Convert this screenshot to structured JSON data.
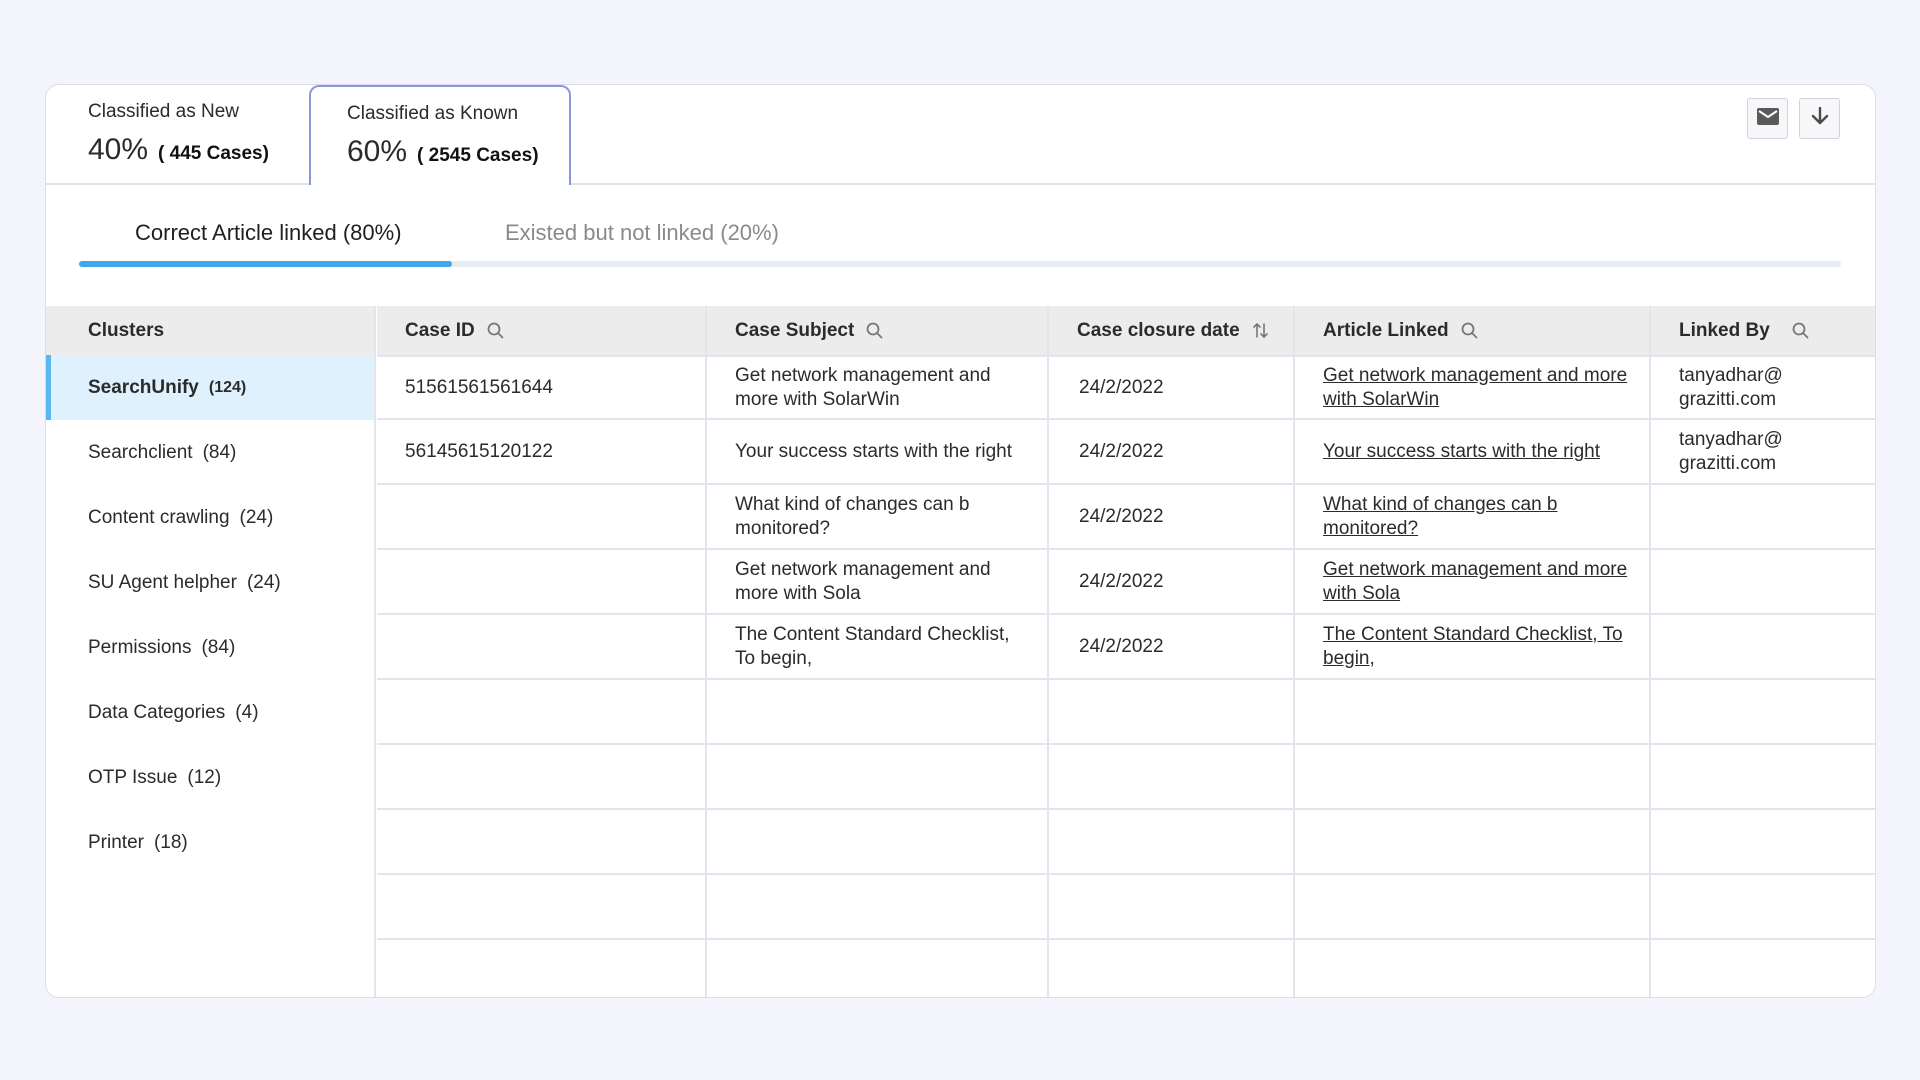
{
  "classification": {
    "new": {
      "label": "Classified as New",
      "percent": "40%",
      "cases": "( 445 Cases)"
    },
    "known": {
      "label": "Classified as Known",
      "percent": "60%",
      "cases": "( 2545 Cases)"
    }
  },
  "actions": {
    "mail_icon": "mail-icon",
    "download_icon": "download-icon"
  },
  "sub_tabs": {
    "active": "Correct Article linked (80%)",
    "inactive": "Existed but not linked (20%)",
    "progress": 0.2
  },
  "clusters": {
    "header": "Clusters",
    "items": [
      {
        "name": "SearchUnify",
        "count": "(124)"
      },
      {
        "name": "Searchclient",
        "count": "(84)"
      },
      {
        "name": "Content crawling",
        "count": "(24)"
      },
      {
        "name": "SU Agent helpher",
        "count": "(24)"
      },
      {
        "name": "Permissions",
        "count": "(84)"
      },
      {
        "name": "Data Categories",
        "count": "(4)"
      },
      {
        "name": "OTP Issue",
        "count": "(12)"
      },
      {
        "name": "Printer",
        "count": "(18)"
      }
    ]
  },
  "table": {
    "columns": [
      "Case ID",
      "Case Subject",
      "Case closure date",
      "Article Linked",
      "Linked By"
    ],
    "rows": [
      [
        "51561561561644",
        "Get network management and more with SolarWin",
        "24/2/2022",
        "Get network management and more with SolarWin",
        "tanyadhar@ grazitti.com"
      ],
      [
        "56145615120122",
        "Your success starts with the right",
        "24/2/2022",
        "Your success starts with the right",
        "tanyadhar@ grazitti.com"
      ],
      [
        "",
        "What kind of changes can b  monitored?",
        "24/2/2022",
        "What kind of changes can b  monitored?",
        ""
      ],
      [
        "",
        "Get network management and more with Sola",
        "24/2/2022",
        "Get network management and more with Sola",
        ""
      ],
      [
        "",
        "The Content Standard Checklist, To begin,",
        "24/2/2022",
        "The Content Standard Checklist, To begin,",
        ""
      ],
      [
        "",
        "",
        "",
        "",
        ""
      ],
      [
        "",
        "",
        "",
        "",
        ""
      ],
      [
        "",
        "",
        "",
        "",
        ""
      ],
      [
        "",
        "",
        "",
        "",
        ""
      ],
      [
        "",
        "",
        "",
        "",
        ""
      ]
    ]
  }
}
